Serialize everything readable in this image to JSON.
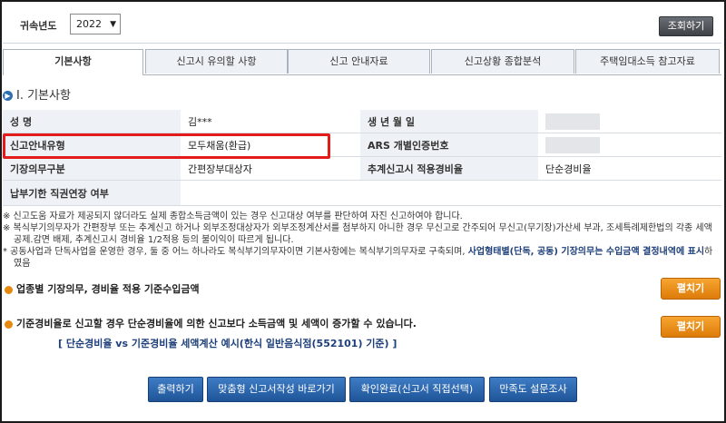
{
  "topbar": {
    "year_label": "귀속년도",
    "year_value": "2022",
    "query_button": "조회하기"
  },
  "tabs": [
    "기본사항",
    "신고시 유의할 사항",
    "신고 안내자료",
    "신고상황 종합분석",
    "주택임대소득 참고자료"
  ],
  "section_title": "Ⅰ. 기본사항",
  "info": {
    "rows": [
      {
        "l1": "성            명",
        "v1": "김***",
        "l2": "생  년  월  일",
        "v2": ""
      },
      {
        "l1": "신고안내유형",
        "v1": "모두채움(환급)",
        "l2": "ARS 개별인증번호",
        "v2": ""
      },
      {
        "l1": "기장의무구분",
        "v1": "간편장부대상자",
        "l2": "추계신고시 적용경비율",
        "v2": "단순경비율"
      },
      {
        "l1": "납부기한 직권연장 여부",
        "v1": "",
        "l2": "",
        "v2": ""
      }
    ]
  },
  "notes": {
    "n1": "※  신고도움 자료가 제공되지 않더라도 실제 종합소득금액이 있는 경우 신고대상 여부를 판단하여 자진 신고하여야 합니다.",
    "n2": "※  복식부기의무자가 간편장부 또는 추계신고 하거나 외부조정대상자가 외부조정계산서를 첨부하지 아니한 경우 무신고로 간주되어 무신고(무기장)가산세 부과, 조세특례제한법의 각종 세액공제.감면 배제, 추계신고시 경비율 1/2적용 등의 불이익이 따르게 됩니다.",
    "n3a": "*  공동사업과 단독사업을 운영한 경우, 둘 중 어느 하나라도 복식부기의무자이면 기본사항에는 복식부기의무자로 구축되며, ",
    "n3b": "사업형태별(단독, 공동) 기장의무는 수입금액 결정내역에 표시",
    "n3c": "하였음"
  },
  "income_section": {
    "title": "업종별 기장의무, 경비율 적용 기준수입금액",
    "button": "펼치기"
  },
  "expense_section": {
    "title": "기준경비율로 신고할 경우 단순경비율에 의한 신고보다 소득금액 및 세액이 증가할 수 있습니다.",
    "button": "펼치기",
    "comparison": "[ 단순경비율 vs 기준경비율 세액계산 예시(한식 일반음식점(552101) 기준) ]"
  },
  "bottom_buttons": [
    "출력하기",
    "맞춤형 신고서작성 바로가기",
    "확인완료(신고서 직접선택)",
    "만족도 설문조사"
  ]
}
